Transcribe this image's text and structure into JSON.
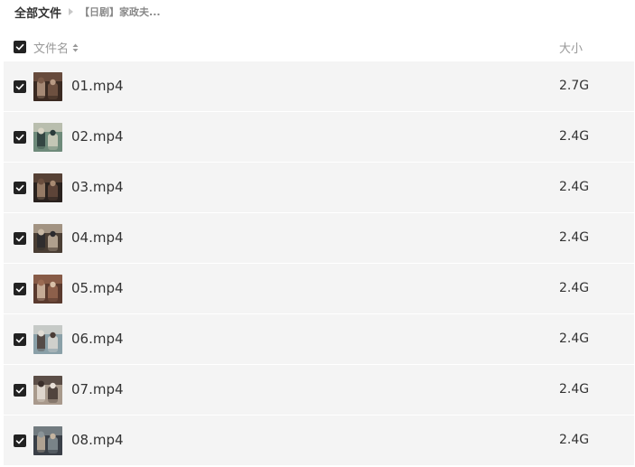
{
  "breadcrumb": {
    "root": "全部文件",
    "current": "【日剧】家政夫..."
  },
  "header": {
    "name_label": "文件名",
    "size_label": "大小",
    "sort_icon": "sort-updown-icon",
    "select_all_checked": true
  },
  "files": [
    {
      "name": "01.mp4",
      "size": "2.7G",
      "checked": true,
      "thumb_colors": [
        "#3a2a22",
        "#7a5a48",
        "#b89a84"
      ]
    },
    {
      "name": "02.mp4",
      "size": "2.4G",
      "checked": true,
      "thumb_colors": [
        "#6e8a7a",
        "#d8d4c4",
        "#2a3a3a"
      ]
    },
    {
      "name": "03.mp4",
      "size": "2.4G",
      "checked": true,
      "thumb_colors": [
        "#2a221e",
        "#6a4e3e",
        "#a88a72"
      ]
    },
    {
      "name": "04.mp4",
      "size": "2.4G",
      "checked": true,
      "thumb_colors": [
        "#4a3e34",
        "#c8b8a4",
        "#2a2a2e"
      ]
    },
    {
      "name": "05.mp4",
      "size": "2.4G",
      "checked": true,
      "thumb_colors": [
        "#5a3a2e",
        "#9a6a52",
        "#d8c0a8"
      ]
    },
    {
      "name": "06.mp4",
      "size": "2.4G",
      "checked": true,
      "thumb_colors": [
        "#8aa0a8",
        "#e0dcd4",
        "#4a3c36"
      ]
    },
    {
      "name": "07.mp4",
      "size": "2.4G",
      "checked": true,
      "thumb_colors": [
        "#a89a8c",
        "#3a2e2a",
        "#e8e0d8"
      ]
    },
    {
      "name": "08.mp4",
      "size": "2.4G",
      "checked": true,
      "thumb_colors": [
        "#3a4048",
        "#8a9498",
        "#c4b4a0"
      ]
    }
  ],
  "colors": {
    "row_bg": "#f4f4f4",
    "checkbox": "#222222",
    "text": "#333333",
    "muted": "#999999"
  }
}
